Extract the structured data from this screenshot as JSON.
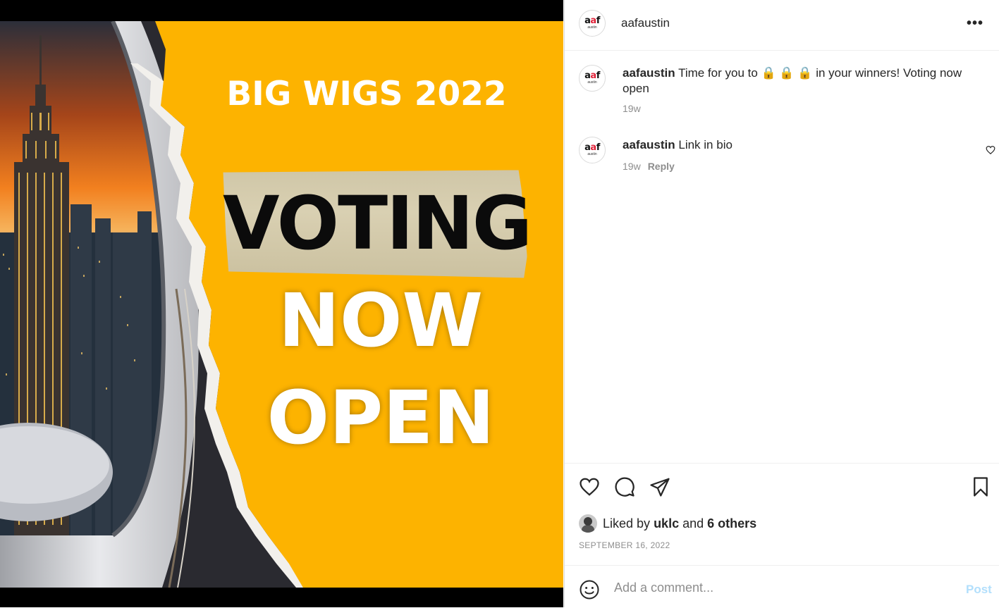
{
  "post_image": {
    "headline": "BIG WIGS 2022",
    "line1": "VOTING",
    "line2": "NOW",
    "line3": "OPEN",
    "background_color": "#fdb300"
  },
  "header": {
    "avatar_logo": "aaf",
    "avatar_sub": "austin",
    "username": "aafaustin",
    "more_icon": "more-horizontal-icon"
  },
  "comments": [
    {
      "username": "aafaustin",
      "text": "Time for you to 🔒 🔒 🔒 in your winners! Voting now open",
      "time": "19w"
    },
    {
      "username": "aafaustin",
      "text": "Link in bio",
      "time": "19w",
      "reply_label": "Reply"
    }
  ],
  "actions": {
    "like_icon": "heart-icon",
    "comment_icon": "comment-icon",
    "share_icon": "share-icon",
    "save_icon": "bookmark-icon"
  },
  "likes": {
    "prefix": "Liked by",
    "user": "uklc",
    "conj": "and",
    "others": "6 others"
  },
  "date": "SEPTEMBER 16, 2022",
  "add_comment": {
    "placeholder": "Add a comment...",
    "post_label": "Post",
    "emoji_icon": "emoji-icon"
  }
}
